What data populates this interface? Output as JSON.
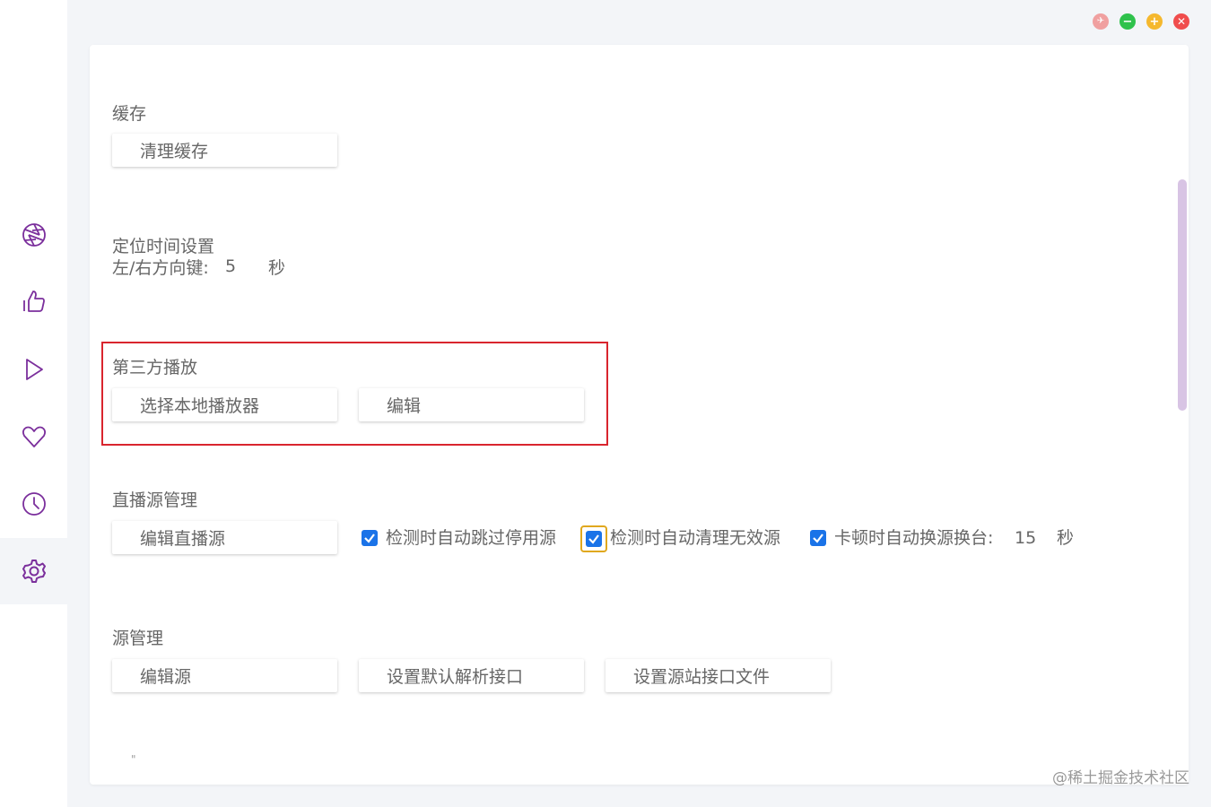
{
  "sidebar": {
    "items": [
      {
        "icon": "aperture-icon",
        "name": "sidebar-item-aperture"
      },
      {
        "icon": "thumbs-up-icon",
        "name": "sidebar-item-recommend"
      },
      {
        "icon": "play-icon",
        "name": "sidebar-item-play"
      },
      {
        "icon": "heart-icon",
        "name": "sidebar-item-favorites"
      },
      {
        "icon": "clock-icon",
        "name": "sidebar-item-history"
      },
      {
        "icon": "gear-icon",
        "name": "sidebar-item-settings",
        "active": true
      }
    ],
    "accent": "#7b2f9c"
  },
  "window_controls": {
    "pin_color": "#f0a0a0",
    "minimize_color": "#2fc24c",
    "maximize_color": "#f5b82e",
    "close_color": "#f04d4d"
  },
  "cache": {
    "title": "缓存",
    "clear_button": "清理缓存"
  },
  "seek": {
    "title": "定位时间设置",
    "label": "左/右方向键:",
    "value": "5",
    "unit": "秒"
  },
  "third_party": {
    "title": "第三方播放",
    "select_button": "选择本地播放器",
    "edit_button": "编辑"
  },
  "live": {
    "title": "直播源管理",
    "edit_button": "编辑直播源",
    "opt_skip_disabled": "检测时自动跳过停用源",
    "opt_clean_invalid": "检测时自动清理无效源",
    "opt_switch_label": "卡顿时自动换源换台:",
    "opt_switch_value": "15",
    "opt_switch_unit": "秒",
    "checked": [
      true,
      true,
      true
    ]
  },
  "source": {
    "title": "源管理",
    "edit_button": "编辑源",
    "default_api_button": "设置默认解析接口",
    "site_file_button": "设置源站接口文件"
  },
  "cut_off_text": "\"",
  "watermark": "@稀土掘金技术社区"
}
